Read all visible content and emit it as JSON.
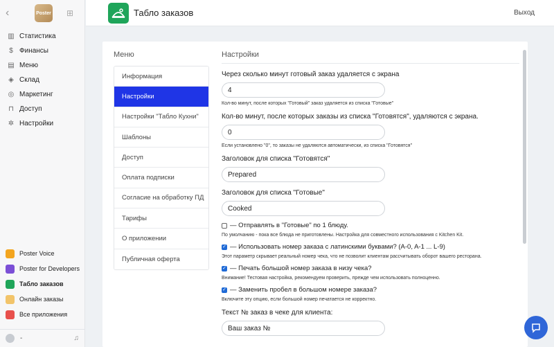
{
  "sidebar": {
    "logo_text": "Poster",
    "nav": [
      {
        "label": "Статистика",
        "icon": "bar-chart-icon",
        "glyph": "▥"
      },
      {
        "label": "Финансы",
        "icon": "dollar-icon",
        "glyph": "$"
      },
      {
        "label": "Меню",
        "icon": "document-icon",
        "glyph": "▤"
      },
      {
        "label": "Склад",
        "icon": "box-icon",
        "glyph": "◈"
      },
      {
        "label": "Маркетинг",
        "icon": "target-icon",
        "glyph": "◎"
      },
      {
        "label": "Доступ",
        "icon": "lock-icon",
        "glyph": "⊓"
      },
      {
        "label": "Настройки",
        "icon": "gear-icon",
        "glyph": "✲"
      }
    ],
    "apps": [
      {
        "label": "Poster Voice",
        "icon": "poster-voice-icon",
        "color": "#f3a51f"
      },
      {
        "label": "Poster for Developers",
        "icon": "developers-icon",
        "color": "#7b4fd6"
      },
      {
        "label": "Табло заказов",
        "icon": "order-board-icon",
        "color": "#1fa55a"
      },
      {
        "label": "Онлайн заказы",
        "icon": "online-orders-icon",
        "color": "#f2c46a"
      },
      {
        "label": "Все приложения",
        "icon": "all-apps-icon",
        "color": "#e8504c"
      }
    ],
    "user_label": "-"
  },
  "header": {
    "title": "Табло заказов",
    "logout_label": "Выход"
  },
  "menu": {
    "title": "Меню",
    "items": [
      "Информация",
      "Настройки",
      "Настройки \"Табло Кухни\"",
      "Шаблоны",
      "Доступ",
      "Оплата подписки",
      "Согласие на обработку ПД",
      "Тарифы",
      "О приложении",
      "Публичная оферта"
    ],
    "active_index": 1
  },
  "settings": {
    "title": "Настройки",
    "delete_minutes_label": "Через сколько минут готовый заказ удаляется с экрана",
    "delete_minutes_value": "4",
    "delete_minutes_hint": "Кол-во минут, после которых \"Готовый\" заказ удаляется из списка \"Готовые\"",
    "preparing_minutes_label": "Кол-во минут, после которых заказы из списка \"Готовятся\", удаляются с экрана.",
    "preparing_minutes_value": "0",
    "preparing_minutes_hint": "Если установлено \"0\", то заказы не удаляются автоматически, из списка \"Готовятся\"",
    "preparing_header_label": "Заголовок для списка \"Готовятся\"",
    "preparing_header_value": "Prepared",
    "ready_header_label": "Заголовок для списка \"Готовые\"",
    "ready_header_value": "Cooked",
    "options": [
      {
        "label": "— Отправлять в \"Готовые\" по 1 блюду.",
        "checked": false,
        "hint": "По умолчанию - пока все блюда не приготовлены. Настройка для совместного использования с Kitchen Kit."
      },
      {
        "label": "— Использовать номер заказа с латинскими буквами? (A-0, A-1 ... L-9)",
        "checked": true,
        "hint": "Этот параметр скрывает реальный номер чека, что не позволит клиентам рассчитывать оборот вашего ресторана."
      },
      {
        "label": "— Печать большой номер заказа в низу чека?",
        "checked": true,
        "hint": "Внимание! Тестовая настройка, рекомендуем проверить, прежде чем использовать полноценно."
      },
      {
        "label": "— Заменить пробел в большом номере заказа?",
        "checked": true,
        "hint": "Включите эту опцию, если большой номер печатается не корректно."
      }
    ],
    "receipt_text_label": "Текст № заказ в чеке для клиента:",
    "receipt_text_value": "Ваш заказ №"
  },
  "colors": {
    "accent": "#1f35e6",
    "brand_green": "#1fa55a",
    "checkbox_blue": "#1f6ad6",
    "chat_button": "#2f66d8"
  }
}
